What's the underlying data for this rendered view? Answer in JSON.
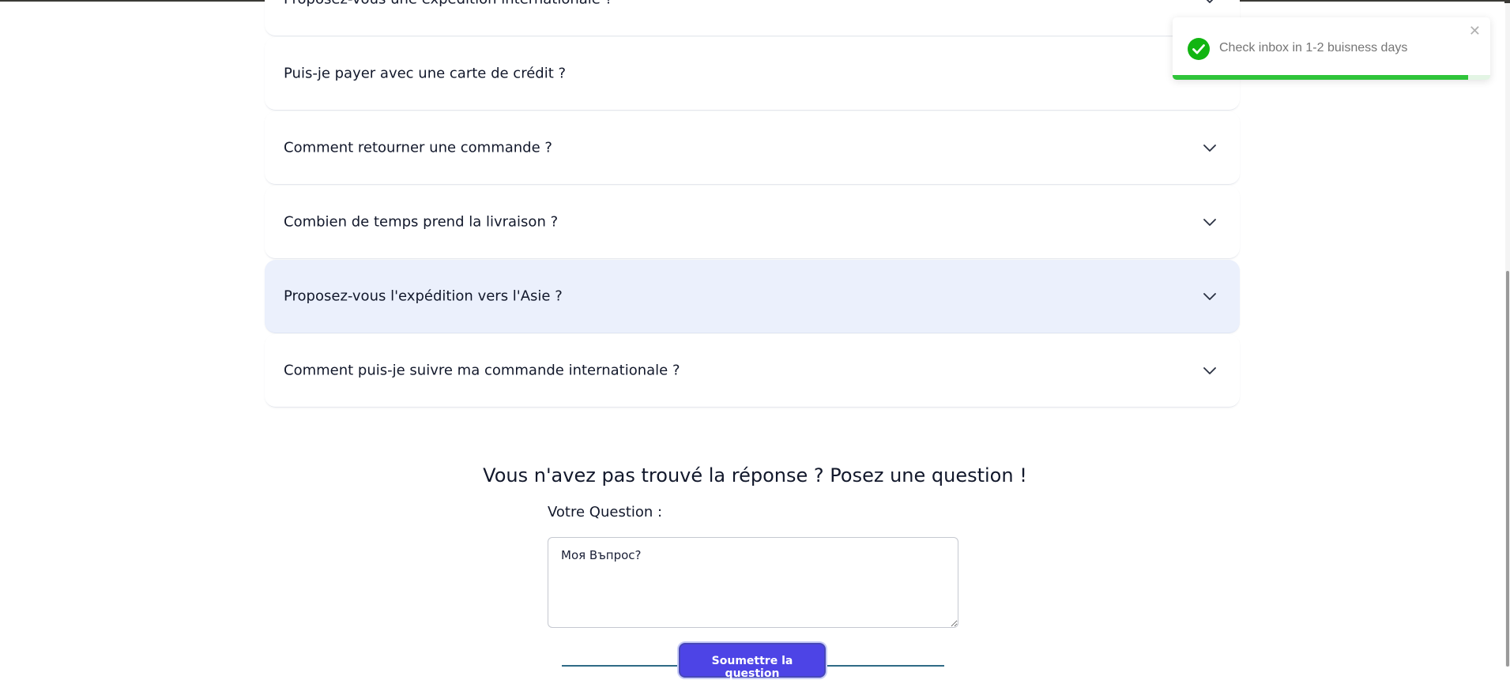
{
  "faq": {
    "items": [
      {
        "question": "Proposez-vous une expédition internationale ?",
        "highlighted": false
      },
      {
        "question": "Puis-je payer avec une carte de crédit ?",
        "highlighted": false
      },
      {
        "question": "Comment retourner une commande ?",
        "highlighted": false
      },
      {
        "question": "Combien de temps prend la livraison ?",
        "highlighted": false
      },
      {
        "question": "Proposez-vous l'expédition vers l'Asie ?",
        "highlighted": true
      },
      {
        "question": "Comment puis-je suivre ma commande internationale ?",
        "highlighted": false
      }
    ],
    "chevron_icon": "chevron-down-icon"
  },
  "ask": {
    "title": "Vous n'avez pas trouvé la réponse ? Posez une question !",
    "label": "Votre Question :",
    "textarea_value": "Моя Въпрос?",
    "submit_label": "Soumettre la question"
  },
  "toast": {
    "message": "Check inbox in 1-2 buisness days",
    "icon": "check-circle-icon",
    "close_icon": "close-icon",
    "close_glyph": "✕",
    "progress_fraction": 0.93,
    "success_color": "#2fc43a"
  },
  "colors": {
    "highlight_bg": "#ebf0fc",
    "button_bg": "#4d44e6",
    "text": "#12182b"
  }
}
